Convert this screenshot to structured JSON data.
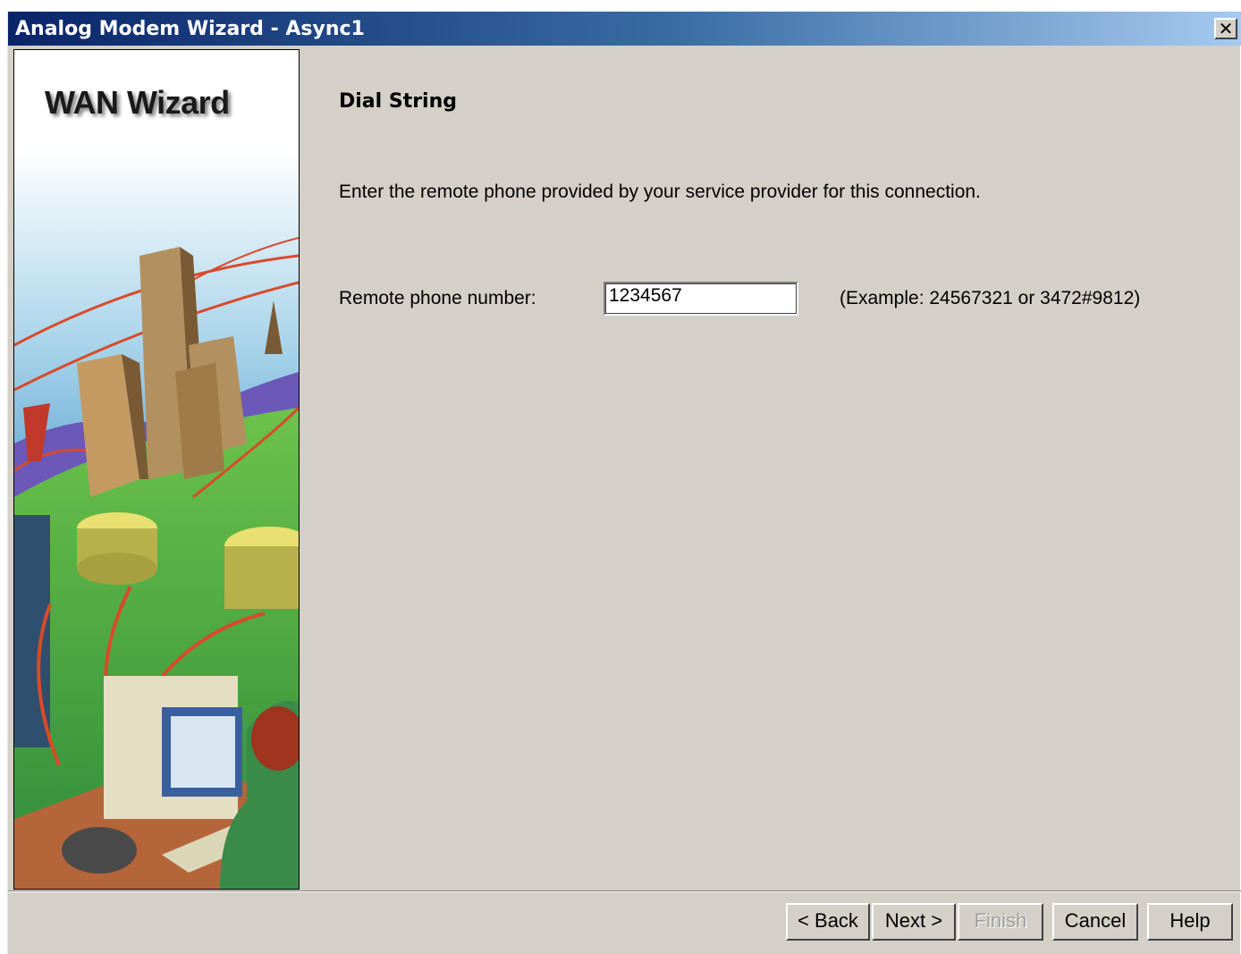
{
  "window": {
    "title": "Analog Modem Wizard - Async1",
    "close_label": "✕"
  },
  "sidebar": {
    "title": "WAN Wizard"
  },
  "main": {
    "heading": "Dial String",
    "instruction": "Enter the remote phone provided by your service provider for this connection.",
    "phone_label": "Remote phone number:",
    "phone_value": "1234567",
    "example": "(Example: 24567321 or 3472#9812)"
  },
  "buttons": {
    "back": "< Back",
    "next": "Next >",
    "finish": "Finish",
    "cancel": "Cancel",
    "help": "Help"
  },
  "colors": {
    "titlebar_start": "#0a246a",
    "titlebar_end": "#a6caf0",
    "dialog_bg": "#d4d0c8"
  }
}
